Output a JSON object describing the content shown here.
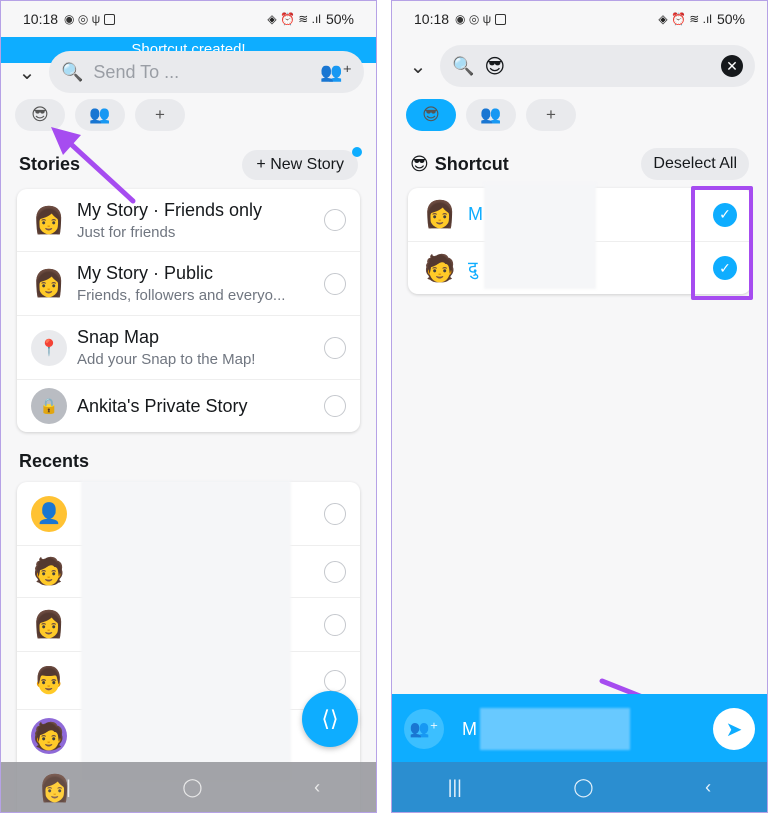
{
  "left": {
    "status": {
      "time": "10:18",
      "battery": "50%"
    },
    "toast": "Shortcut created!",
    "search": {
      "placeholder": "Send To ..."
    },
    "chips": [
      "😎",
      "👥",
      "+"
    ],
    "stories_title": "Stories",
    "new_story": "+ New Story",
    "stories": [
      {
        "title": "My Story · Friends only",
        "subtitle": "Just for friends",
        "avatar": "👩"
      },
      {
        "title": "My Story · Public",
        "subtitle": "Friends, followers and everyo...",
        "avatar": "👩"
      },
      {
        "title": "Snap Map",
        "subtitle": "Add your Snap to the Map!",
        "avatar": "📍"
      },
      {
        "title": "Ankita's Private Story",
        "subtitle": "",
        "avatar": "🔒"
      }
    ],
    "recents_title": "Recents",
    "recents": [
      {
        "avatar": "👤"
      },
      {
        "avatar": "🧑"
      },
      {
        "avatar": "👩"
      },
      {
        "avatar": "👨"
      },
      {
        "avatar": "🧑"
      },
      {
        "avatar": "👩"
      }
    ],
    "nav": [
      "|||",
      "◯",
      "‹"
    ]
  },
  "right": {
    "status": {
      "time": "10:18",
      "battery": "50%"
    },
    "search": {
      "emoji": "😎"
    },
    "chips": [
      "😎",
      "👥",
      "+"
    ],
    "shortcut_title": "Shortcut",
    "shortcut_emoji": "😎",
    "deselect": "Deselect All",
    "selected": [
      {
        "name": "M",
        "avatar": "👩"
      },
      {
        "name": "दु",
        "avatar": "🧑"
      }
    ],
    "sendbar": {
      "recipient": "M"
    },
    "nav": [
      "|||",
      "◯",
      "‹"
    ]
  },
  "colors": {
    "accent": "#0eadff",
    "highlight": "#a64cf0"
  }
}
